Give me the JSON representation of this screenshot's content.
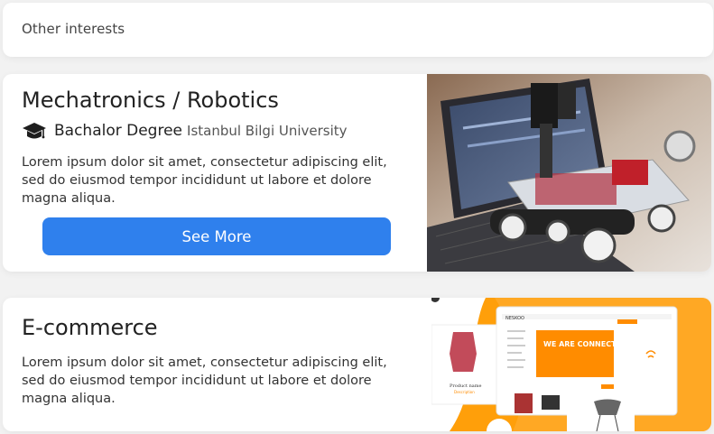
{
  "interests": {
    "label": "Other interests"
  },
  "robotics": {
    "title": "Mechatronics / Robotics",
    "degree": "Bachalor Degree",
    "university": "Istanbul Bilgi University",
    "description": "Lorem ipsum dolor sit amet, consectetur adipiscing elit, sed do eiusmod tempor incididunt ut labore et dolore magna aliqua.",
    "button_label": "See More",
    "image_icon": "robot-photo"
  },
  "ecommerce": {
    "title": "E-commerce",
    "description": "Lorem ipsum dolor sit amet, consectetur adipiscing elit, sed do eiusmod tempor incididunt ut labore et dolore magna aliqua.",
    "image_icon": "ecommerce-illustration",
    "illustration": {
      "banner_text": "WE ARE CONNECTED!",
      "brand": "NESKOO",
      "product_name": "Product name",
      "product_desc": "Description"
    }
  },
  "colors": {
    "accent": "#2f80ed",
    "orange": "#ff9f0a"
  }
}
